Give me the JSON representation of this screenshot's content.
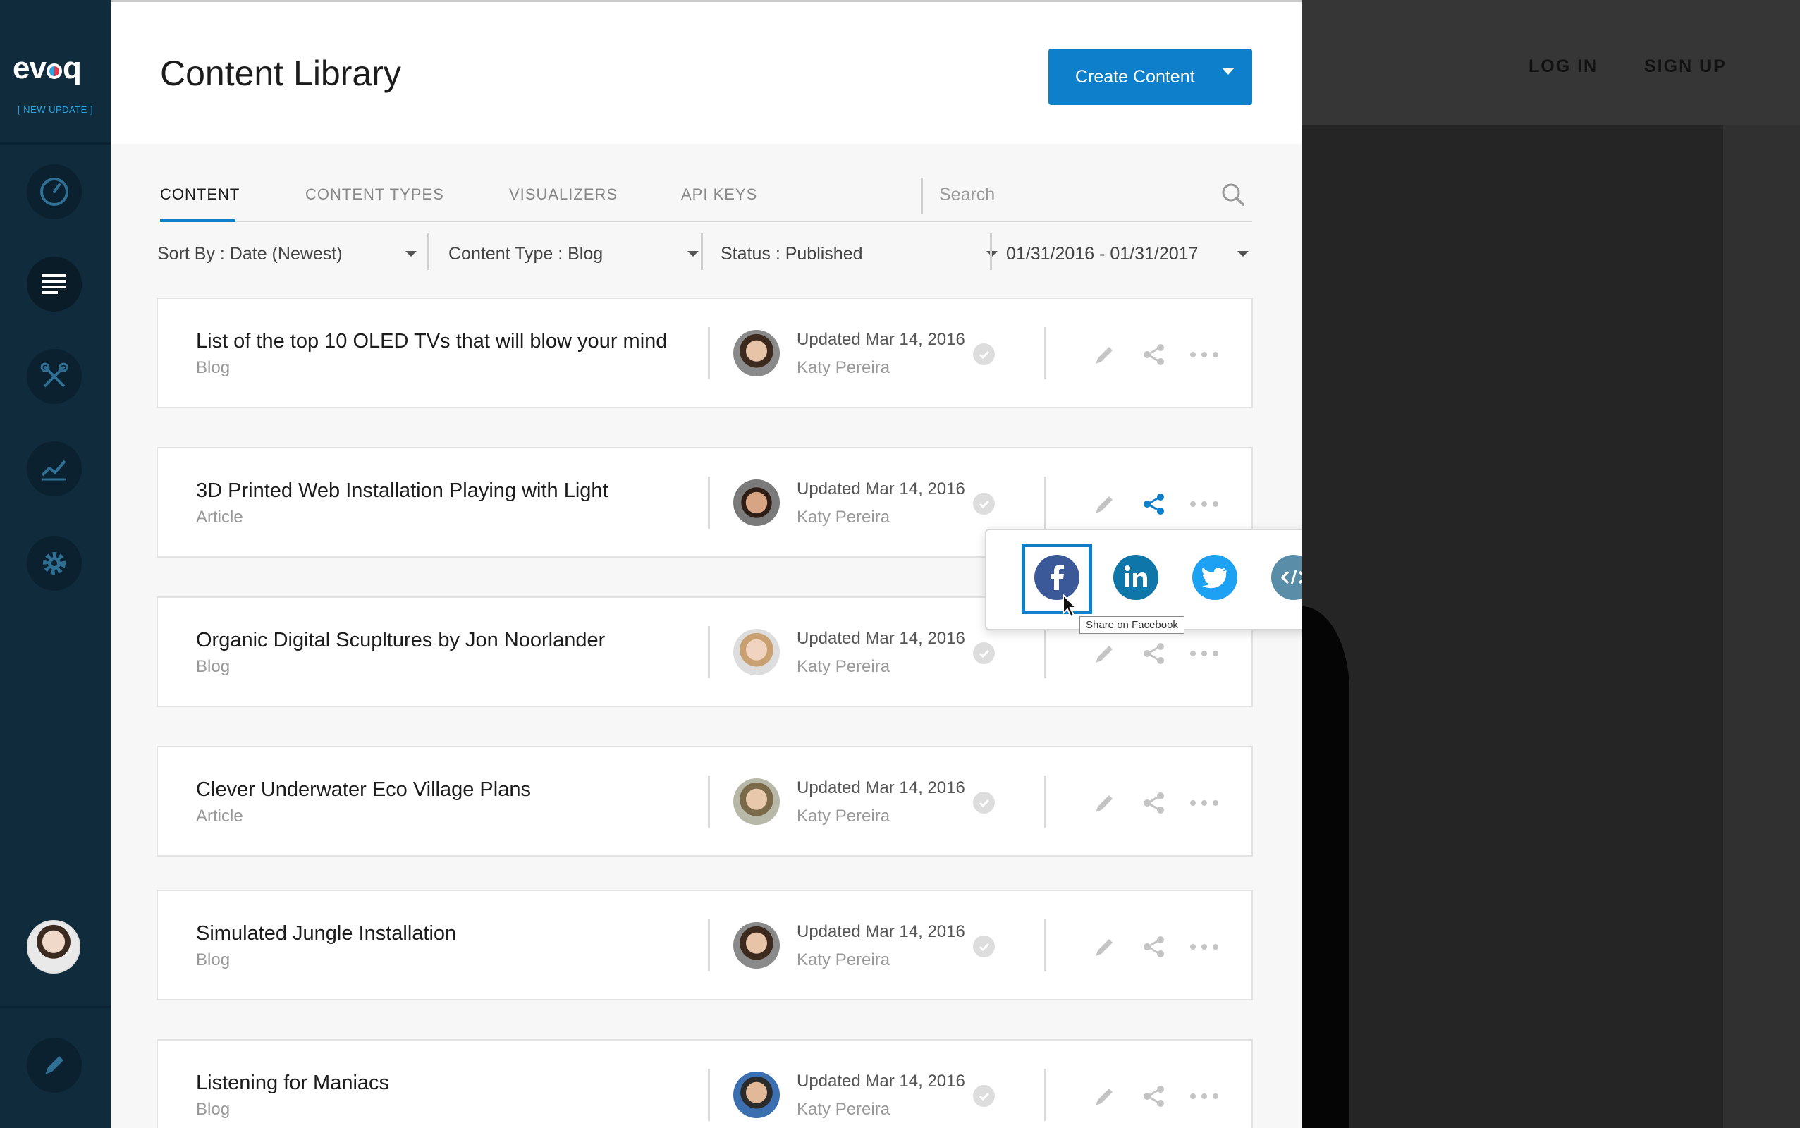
{
  "app": {
    "logo_text_a": "ev",
    "logo_text_b": "q",
    "update_tag": "[ NEW UPDATE ]"
  },
  "site": {
    "login": "LOG IN",
    "signup": "SIGN UP"
  },
  "sidebar": {
    "items": [
      {
        "name": "dashboard",
        "icon": "gauge-icon"
      },
      {
        "name": "content",
        "icon": "content-list-icon"
      },
      {
        "name": "tools",
        "icon": "tools-icon"
      },
      {
        "name": "analytics",
        "icon": "chart-line-icon"
      },
      {
        "name": "settings",
        "icon": "gear-icon"
      }
    ],
    "bottom_action": "pencil-icon"
  },
  "header": {
    "title": "Content Library",
    "create_label": "Create  Content"
  },
  "tabs": [
    {
      "label": "CONTENT",
      "active": true
    },
    {
      "label": "CONTENT TYPES",
      "active": false
    },
    {
      "label": "VISUALIZERS",
      "active": false
    },
    {
      "label": "API KEYS",
      "active": false
    }
  ],
  "search": {
    "placeholder": "Search"
  },
  "filters": {
    "sort": "Sort By : Date (Newest)",
    "type": "Content Type : Blog",
    "status": "Status : Published",
    "dates": "01/31/2016 - 01/31/2017"
  },
  "rows": [
    {
      "title": "List of the top 10 OLED TVs that will blow your mind",
      "type": "Blog",
      "updated": "Updated Mar 14, 2016",
      "author": "Katy Pereira"
    },
    {
      "title": "3D Printed Web Installation Playing with Light",
      "type": "Article",
      "updated": "Updated Mar 14, 2016",
      "author": "Katy Pereira"
    },
    {
      "title": "Organic Digital Scupltures by Jon Noorlander",
      "type": "Blog",
      "updated": "Updated Mar 14, 2016",
      "author": "Katy Pereira"
    },
    {
      "title": "Clever Underwater Eco Village Plans",
      "type": "Article",
      "updated": "Updated Mar 14, 2016",
      "author": "Katy Pereira"
    },
    {
      "title": "Simulated Jungle Installation",
      "type": "Blog",
      "updated": "Updated Mar 14, 2016",
      "author": "Katy Pereira"
    },
    {
      "title": "Listening for Maniacs",
      "type": "Blog",
      "updated": "Updated Mar 14, 2016",
      "author": "Katy Pereira"
    }
  ],
  "share_menu": {
    "options": [
      "facebook-icon",
      "linkedin-icon",
      "twitter-icon",
      "embed-code-icon"
    ],
    "tooltip": "Share on Facebook"
  },
  "colors": {
    "accent": "#0d7fcb",
    "sidebar": "#0f2b3c",
    "facebook": "#3b5998",
    "linkedin": "#0e76a8",
    "twitter": "#1da1f2",
    "embed": "#5a8ea8"
  }
}
